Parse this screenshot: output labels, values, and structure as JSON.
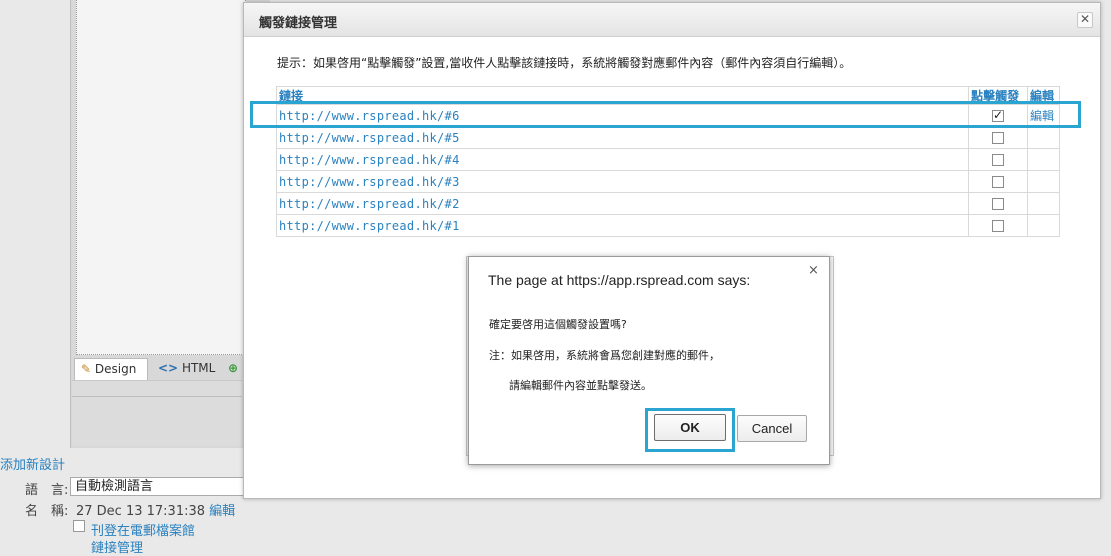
{
  "background": {
    "toolbar": {
      "design_label": "Design",
      "html_label": "HTML"
    },
    "add_design_link": "添加新設計",
    "language_label": "語　言:",
    "language_value": "自動檢測語言",
    "name_label": "名　稱:",
    "name_value": "27 Dec 13 17:31:38",
    "name_edit": "編輯",
    "publish_link": "刊登在電郵檔案館",
    "link_manager_link": "鏈接管理"
  },
  "modal": {
    "title": "觸發鏈接管理",
    "close": "✕",
    "hint": "提示：如果啓用“點擊觸發”設置,當收件人點擊該鏈接時，系統將觸發對應郵件內容（郵件內容須自行編輯）。",
    "columns": {
      "url": "鏈接",
      "trigger": "點擊觸發",
      "edit": "編輯"
    },
    "rows": [
      {
        "url": "http://www.rspread.hk/#6",
        "checked": true,
        "edit": "編輯"
      },
      {
        "url": "http://www.rspread.hk/#5",
        "checked": false,
        "edit": ""
      },
      {
        "url": "http://www.rspread.hk/#4",
        "checked": false,
        "edit": ""
      },
      {
        "url": "http://www.rspread.hk/#3",
        "checked": false,
        "edit": ""
      },
      {
        "url": "http://www.rspread.hk/#2",
        "checked": false,
        "edit": ""
      },
      {
        "url": "http://www.rspread.hk/#1",
        "checked": false,
        "edit": ""
      }
    ]
  },
  "alert": {
    "close": "×",
    "title": "The page at https://app.rspread.com says:",
    "message_line1": "確定要啓用這個觸發設置嗎?",
    "message_line2": "注：如果啓用，系統將會爲您創建對應的郵件，",
    "message_line3": "請編輯郵件內容並點擊發送。",
    "ok_label": "OK",
    "cancel_label": "Cancel"
  },
  "colors": {
    "link": "#2a82c0",
    "highlight": "#2aa4d0"
  }
}
